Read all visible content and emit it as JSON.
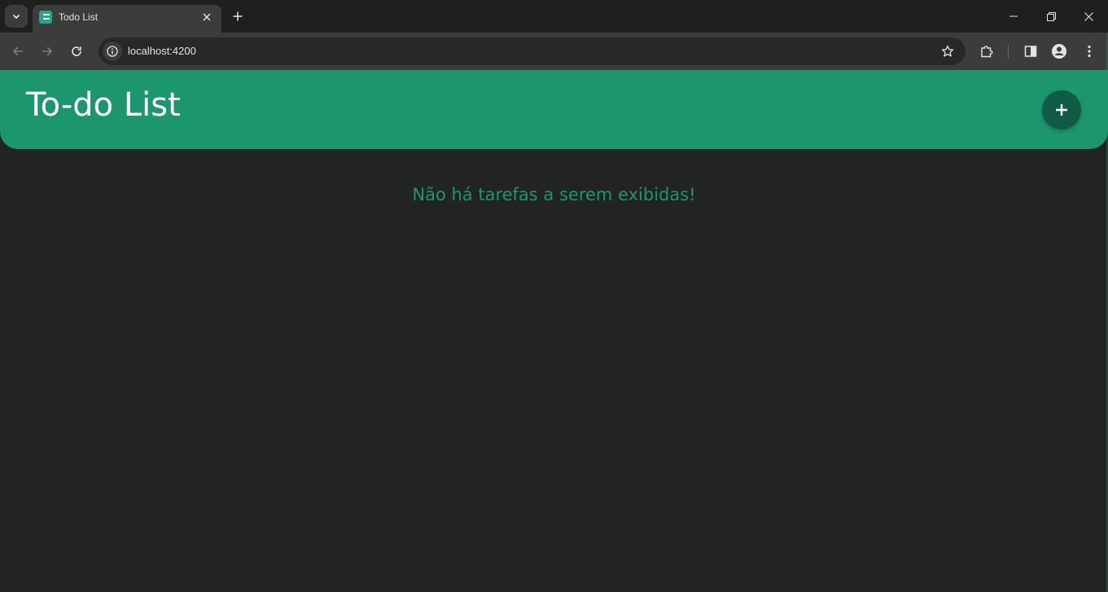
{
  "browser": {
    "tab_title": "Todo List",
    "url": "localhost:4200"
  },
  "app": {
    "title": "To-do List",
    "add_button_symbol": "+",
    "empty_message": "Não há tarefas a serem exibidas!"
  },
  "colors": {
    "accent": "#1c966c",
    "accent_dark": "#0f5b45",
    "background": "#222325"
  },
  "icons": {
    "tab_search": "chevron-down-icon",
    "favicon": "todo-favicon-icon",
    "tab_close": "close-icon",
    "new_tab": "plus-icon",
    "minimize": "minimize-icon",
    "restore": "restore-icon",
    "close_window": "close-icon",
    "back": "back-arrow-icon",
    "forward": "forward-arrow-icon",
    "reload": "reload-icon",
    "site_info": "info-icon",
    "bookmark": "star-icon",
    "extensions": "puzzle-icon",
    "side_panel": "side-panel-icon",
    "profile": "profile-icon",
    "menu": "kebab-menu-icon",
    "add_task": "plus-icon"
  }
}
